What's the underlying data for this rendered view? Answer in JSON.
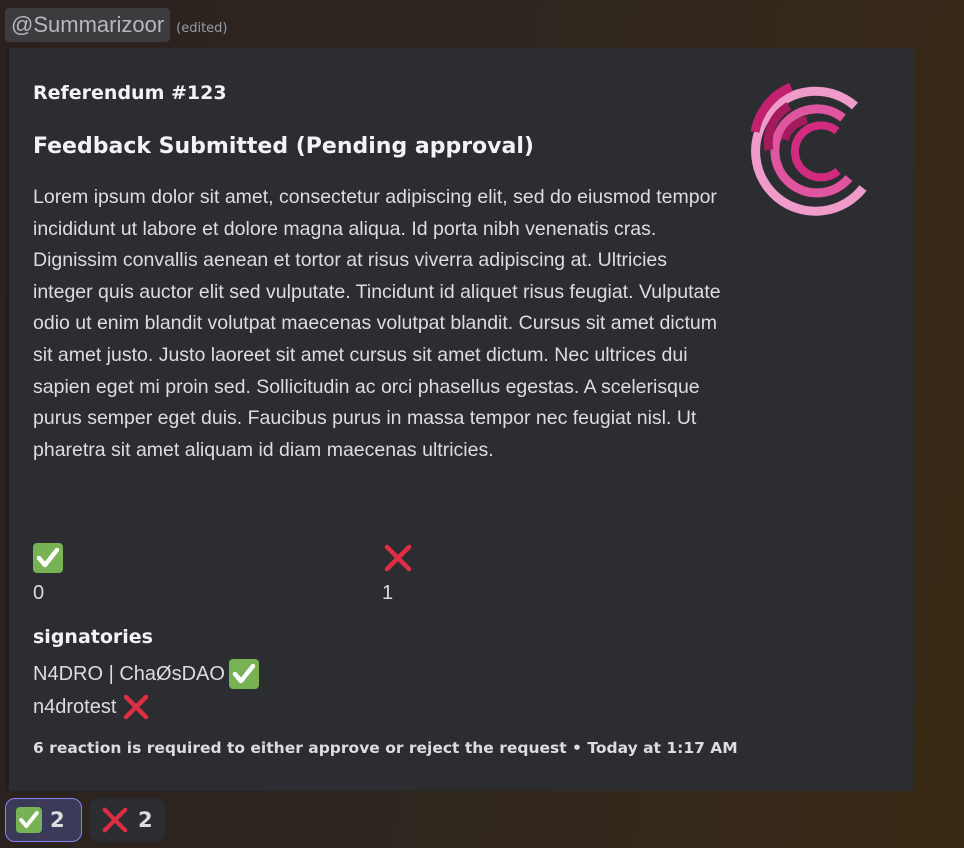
{
  "author": {
    "mention": "@Summarizoor",
    "edited": "(edited)"
  },
  "embed": {
    "ref_title": "Referendum #123",
    "heading": "Feedback Submitted (Pending approval)",
    "description": "Lorem ipsum dolor sit amet, consectetur adipiscing elit, sed do eiusmod tempor incididunt ut labore et dolore magna aliqua. Id porta nibh venenatis cras. Dignissim convallis aenean et tortor at risus viverra adipiscing at. Ultricies integer quis auctor elit sed vulputate. Tincidunt id aliquet risus feugiat. Vulputate odio ut enim blandit volutpat maecenas volutpat blandit. Cursus sit amet dictum sit amet justo. Justo laoreet sit amet cursus sit amet dictum. Nec ultrices dui sapien eget mi proin sed. Sollicitudin ac orci phasellus egestas. A scelerisque purus semper eget duis. Faucibus purus in massa tempor nec feugiat nisl. Ut pharetra sit amet aliquam id diam maecenas ultricies.",
    "fields": {
      "approve": {
        "icon": "check-mark-icon",
        "value": "0"
      },
      "reject": {
        "icon": "cross-mark-icon",
        "value": "1"
      }
    },
    "signatories": {
      "title": "signatories",
      "rows": [
        {
          "name": "N4DRO | ChaØsDAO",
          "icon": "check-mark-icon"
        },
        {
          "name": "n4drotest",
          "icon": "cross-mark-icon"
        }
      ]
    },
    "footer": "6 reaction is required to either approve or reject the request • Today at 1:17 AM"
  },
  "reactions": [
    {
      "icon": "check-mark-icon",
      "count": "2",
      "selected": true
    },
    {
      "icon": "cross-mark-icon",
      "count": "2",
      "selected": false
    }
  ],
  "colors": {
    "check_green": "#77b255",
    "cross_red": "#dd2e44",
    "logo_pink": "#e6007a"
  }
}
